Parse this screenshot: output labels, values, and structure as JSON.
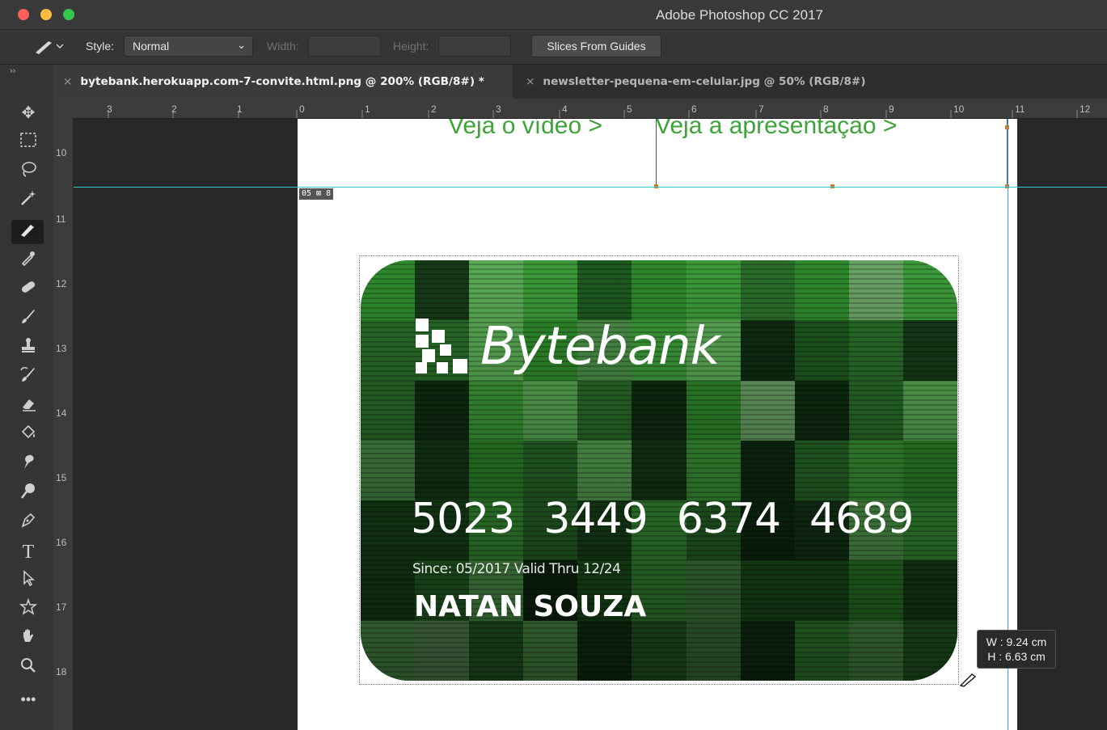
{
  "app": {
    "title": "Adobe Photoshop CC 2017"
  },
  "options": {
    "style_label": "Style:",
    "style_value": "Normal",
    "width_label": "Width:",
    "height_label": "Height:",
    "slices_button": "Slices From Guides"
  },
  "tabs": [
    {
      "label": "bytebank.herokuapp.com-7-convite.html.png @ 200% (RGB/8#) *",
      "close": "×"
    },
    {
      "label": "newsletter-pequena-em-celular.jpg @ 50% (RGB/8#)",
      "close": "×"
    }
  ],
  "panel_toggle": "››",
  "ruler_top": [
    "3",
    "2",
    "1",
    "0",
    "1",
    "2",
    "3",
    "4",
    "5",
    "6",
    "7",
    "8",
    "9",
    "10",
    "11",
    "12"
  ],
  "ruler_left": [
    "10",
    "11",
    "12",
    "13",
    "14",
    "15",
    "16",
    "17",
    "18"
  ],
  "page": {
    "link1": "Veja o vídeo >",
    "link2": "Veja a apresentação >",
    "slice_badge": "05 ⊠ 8"
  },
  "card": {
    "brand": "Bytebank",
    "number": [
      "5023",
      "3449",
      "6374",
      "4689"
    ],
    "since": "Since: 05/2017  Valid Thru 12/24",
    "holder": "NATAN SOUZA"
  },
  "tooltip": {
    "w": "W : 9.24 cm",
    "h": "H : 6.63 cm"
  },
  "colors": {
    "accent_green": "#3fa33a",
    "guide_cyan": "#2ec8d6",
    "slice_handle": "#d57b1d"
  },
  "tools": [
    "move-icon",
    "marquee-icon",
    "lasso-icon",
    "magic-wand-icon",
    "slice-icon",
    "eyedropper-icon",
    "healing-icon",
    "brush-icon",
    "stamp-icon",
    "history-brush-icon",
    "eraser-icon",
    "paint-bucket-icon",
    "smudge-icon",
    "dodge-icon",
    "pen-icon",
    "type-icon",
    "path-select-icon",
    "shape-icon",
    "hand-icon",
    "zoom-icon",
    "more-icon"
  ]
}
